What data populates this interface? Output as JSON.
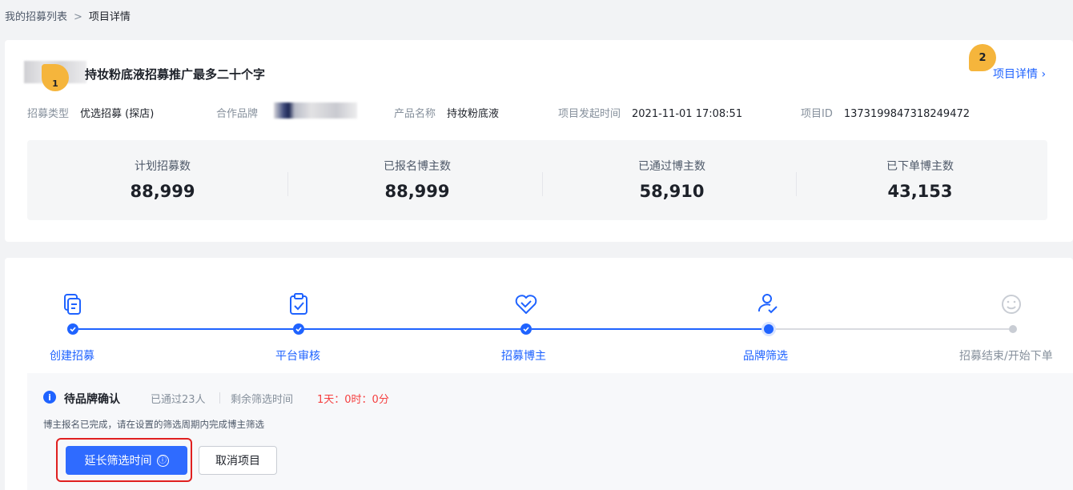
{
  "breadcrumb": {
    "parent": "我的招募列表",
    "separator": ">",
    "current": "项目详情"
  },
  "project": {
    "title": "持妆粉底液招募推广最多二十个字",
    "detail_link": "项目详情 ›",
    "tour_badges": [
      "1",
      "2"
    ]
  },
  "info": {
    "type_label": "招募类型",
    "type_value": "优选招募 (探店)",
    "brand_label": "合作品牌",
    "product_label": "产品名称",
    "product_value": "持妆粉底液",
    "start_label": "项目发起时间",
    "start_value": "2021-11-01 17:08:51",
    "id_label": "项目ID",
    "id_value": "1373199847318249472"
  },
  "stats": [
    {
      "title": "计划招募数",
      "value": "88,999"
    },
    {
      "title": "已报名博主数",
      "value": "88,999"
    },
    {
      "title": "已通过博主数",
      "value": "58,910"
    },
    {
      "title": "已下单博主数",
      "value": "43,153"
    }
  ],
  "steps": [
    {
      "label": "创建招募",
      "icon": "document-copy-icon",
      "status": "done"
    },
    {
      "label": "平台审核",
      "icon": "clipboard-check-icon",
      "status": "done"
    },
    {
      "label": "招募博主",
      "icon": "handshake-heart-icon",
      "status": "done"
    },
    {
      "label": "品牌筛选",
      "icon": "user-check-icon",
      "status": "current"
    },
    {
      "label": "招募结束/开始下单",
      "icon": "smile-icon",
      "status": "pending"
    }
  ],
  "notice": {
    "icon": "info-icon",
    "title": "待品牌确认",
    "passed": "已通过23人",
    "remaining_label": "剩余筛选时间",
    "remaining_value": "1天：0时：0分",
    "description": "博主报名已完成，请在设置的筛选周期内完成博主筛选"
  },
  "actions": {
    "extend_label": "延长筛选时间",
    "extend_icon": "ⓘ",
    "cancel_label": "取消项目"
  },
  "colors": {
    "primary": "#1f63ff",
    "danger": "#f53f3f",
    "badge": "#f5b53c",
    "highlight": "#e02020"
  }
}
